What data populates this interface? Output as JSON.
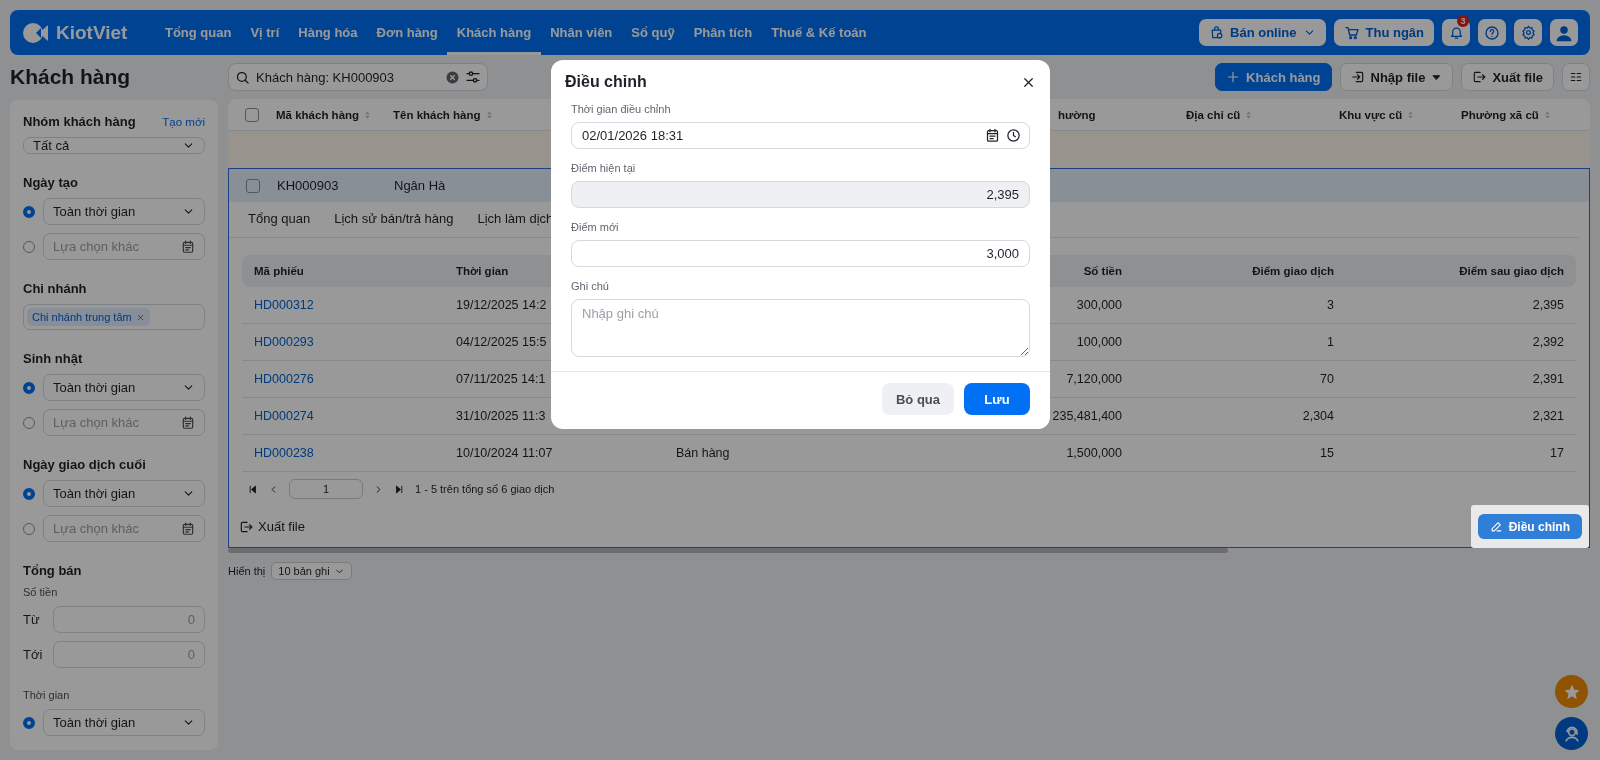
{
  "nav": {
    "logo": "KiotViet",
    "items": [
      {
        "label": "Tổng quan",
        "selected": false
      },
      {
        "label": "Vị trí",
        "selected": false
      },
      {
        "label": "Hàng hóa",
        "selected": false
      },
      {
        "label": "Đơn hàng",
        "selected": false
      },
      {
        "label": "Khách hàng",
        "selected": true
      },
      {
        "label": "Nhân viên",
        "selected": false
      },
      {
        "label": "Sổ quỹ",
        "selected": false
      },
      {
        "label": "Phân tích",
        "selected": false
      },
      {
        "label": "Thuế & Kế toán",
        "selected": false
      }
    ],
    "actions": [
      {
        "kind": "online",
        "label": "Bán online"
      },
      {
        "kind": "cashier",
        "label": "Thu ngân"
      }
    ],
    "notification_count": "3"
  },
  "page_title": "Khách hàng",
  "search": {
    "value": "Khách hàng: KH000903"
  },
  "toolbar": [
    {
      "kind": "add",
      "label": "Khách hàng"
    },
    {
      "kind": "import",
      "label": "Nhập file"
    },
    {
      "kind": "export",
      "label": "Xuất file"
    }
  ],
  "sidebar": {
    "sections": [
      {
        "kind": "select",
        "title": "Nhóm khách hàng",
        "link": "Tạo mới",
        "value": "Tất cả"
      },
      {
        "kind": "date",
        "title": "Ngày tạo",
        "options": [
          {
            "kind": "select",
            "value": "Toàn thời gian",
            "selected": true
          },
          {
            "kind": "picker",
            "placeholder": "Lựa chọn khác",
            "selected": false
          }
        ]
      },
      {
        "kind": "tags",
        "title": "Chi nhánh",
        "tags": [
          "Chi nhánh trung tâm"
        ]
      },
      {
        "kind": "date",
        "title": "Sinh nhật",
        "options": [
          {
            "kind": "select",
            "value": "Toàn thời gian",
            "selected": true
          },
          {
            "kind": "picker",
            "placeholder": "Lựa chọn khác",
            "selected": false
          }
        ]
      },
      {
        "kind": "date",
        "title": "Ngày giao dịch cuối",
        "options": [
          {
            "kind": "select",
            "value": "Toàn thời gian",
            "selected": true
          },
          {
            "kind": "picker",
            "placeholder": "Lựa chọn khác",
            "selected": false
          }
        ]
      },
      {
        "kind": "range",
        "title": "Tổng bán",
        "subtitle": "Số tiền",
        "fields": [
          {
            "label": "Từ",
            "placeholder": "0"
          },
          {
            "label": "Tới",
            "placeholder": "0"
          }
        ]
      },
      {
        "kind": "date",
        "subtitle": "Thời gian",
        "options": [
          {
            "kind": "select",
            "value": "Toàn thời gian",
            "selected": true
          }
        ]
      }
    ]
  },
  "customers_table": {
    "header_checked": false,
    "columns_left": [
      "Mã khách hàng",
      "Tên khách hàng"
    ],
    "columns_right": [
      "hường",
      "Địa chỉ cũ",
      "Khu vực cũ",
      "Phường xã cũ"
    ],
    "selected_row": {
      "checked": false,
      "code": "KH000903",
      "name": "Ngân Hà"
    }
  },
  "detail": {
    "tabs": [
      {
        "label": "Tổng quan",
        "selected": false
      },
      {
        "label": "Lịch sử bán/trả hàng",
        "selected": false
      },
      {
        "label": "Lịch làm dịch",
        "selected": false
      }
    ],
    "columns": {
      "code": "Mã phiếu",
      "time": "Thời gian",
      "amount": "Số tiền",
      "points": "Điểm giao dịch",
      "balance": "Điểm sau giao dịch"
    },
    "rows": [
      {
        "code": "HD000312",
        "time": "19/12/2025 14:2",
        "amount": "300,000",
        "points": "3",
        "balance": "2,395"
      },
      {
        "code": "HD000293",
        "time": "04/12/2025 15:5",
        "amount": "100,000",
        "points": "1",
        "balance": "2,392"
      },
      {
        "code": "HD000276",
        "time": "07/11/2025 14:1",
        "amount": "7,120,000",
        "points": "70",
        "balance": "2,391"
      },
      {
        "code": "HD000274",
        "time": "31/10/2025 11:3",
        "amount": "235,481,400",
        "points": "2,304",
        "balance": "2,321"
      },
      {
        "code": "HD000238",
        "time": "10/10/2024 11:07",
        "type": "Bán hàng",
        "amount": "1,500,000",
        "points": "15",
        "balance": "17"
      }
    ],
    "pager": {
      "page": "1",
      "info": "1 - 5 trên tổng số 6 giao dịch"
    },
    "export": "Xuất file",
    "adjust": "Điều chỉnh"
  },
  "page_size": {
    "label": "Hiển thị",
    "value": "10 bản ghi"
  },
  "modal": {
    "title": "Điều chỉnh",
    "fields": [
      {
        "kind": "datetime",
        "label": "Thời gian điều chỉnh",
        "value": "02/01/2026 18:31"
      },
      {
        "kind": "readonly",
        "label": "Điểm hiện tại",
        "value": "2,395"
      },
      {
        "kind": "number",
        "label": "Điểm mới",
        "value": "3,000"
      },
      {
        "kind": "textarea",
        "label": "Ghi chú",
        "placeholder": "Nhập ghi chú"
      }
    ],
    "buttons": [
      {
        "kind": "secondary",
        "label": "Bỏ qua"
      },
      {
        "kind": "primary",
        "label": "Lưu"
      }
    ]
  }
}
